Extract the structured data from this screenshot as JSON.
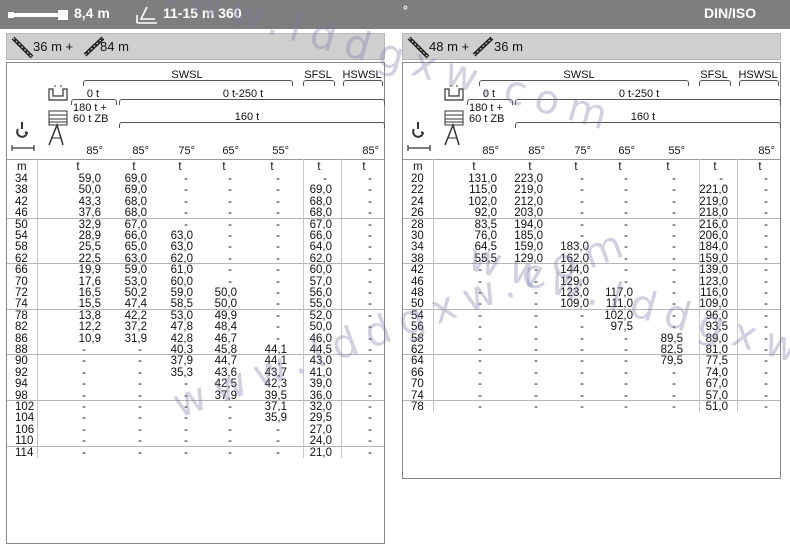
{
  "top_bar": {
    "boom_length": "8,4 m",
    "counterweight": "11-15 m 360",
    "degree": "°",
    "standard": "DIN/ISO"
  },
  "left": {
    "config_a": "36 m +",
    "config_b": "84 m",
    "swsl": "SWSL",
    "sfsl": "SFSL",
    "hswsl": "HSWSL",
    "ballast_low": "0 t",
    "ballast_range": "0 t-250 t",
    "ballast_extra": "180 t +\n60 t ZB",
    "ballast_main": "160 t",
    "angles": [
      "85°",
      "85°",
      "75°",
      "65°",
      "55°",
      "",
      "85°"
    ],
    "units": [
      "m",
      "t",
      "t",
      "t",
      "t",
      "t",
      "t",
      "t"
    ],
    "rows": [
      [
        "34",
        "59,0",
        "69,0",
        "-",
        "-",
        "-",
        "-",
        "-"
      ],
      [
        "38",
        "50,0",
        "69,0",
        "-",
        "-",
        "-",
        "69,0",
        "-"
      ],
      [
        "42",
        "43,3",
        "68,0",
        "-",
        "-",
        "-",
        "68,0",
        "-"
      ],
      [
        "46",
        "37,6",
        "68,0",
        "-",
        "-",
        "-",
        "68,0",
        "-"
      ],
      [
        "50",
        "32,9",
        "67,0",
        "-",
        "-",
        "-",
        "67,0",
        "-"
      ],
      [
        "54",
        "28,9",
        "66,0",
        "63,0",
        "-",
        "-",
        "66,0",
        "-"
      ],
      [
        "58",
        "25,5",
        "65,0",
        "63,0",
        "-",
        "-",
        "64,0",
        "-"
      ],
      [
        "62",
        "22,5",
        "63,0",
        "62,0",
        "-",
        "-",
        "62,0",
        "-"
      ],
      [
        "66",
        "19,9",
        "59,0",
        "61,0",
        "-",
        "-",
        "60,0",
        "-"
      ],
      [
        "70",
        "17,6",
        "53,0",
        "60,0",
        "-",
        "-",
        "57,0",
        "-"
      ],
      [
        "72",
        "16,5",
        "50,2",
        "59,0",
        "50,0",
        "-",
        "56,0",
        "-"
      ],
      [
        "74",
        "15,5",
        "47,4",
        "58,5",
        "50,0",
        "-",
        "55,0",
        "-"
      ],
      [
        "78",
        "13,8",
        "42,2",
        "53,0",
        "49,9",
        "-",
        "52,0",
        "-"
      ],
      [
        "82",
        "12,2",
        "37,2",
        "47,8",
        "48,4",
        "-",
        "50,0",
        "-"
      ],
      [
        "86",
        "10,9",
        "31,9",
        "42,8",
        "46,7",
        "-",
        "46,0",
        "-"
      ],
      [
        "88",
        "-",
        "-",
        "40,3",
        "45,8",
        "44,1",
        "44,5",
        "-"
      ],
      [
        "90",
        "-",
        "-",
        "37,9",
        "44,7",
        "44,1",
        "43,0",
        "-"
      ],
      [
        "92",
        "-",
        "-",
        "35,3",
        "43,6",
        "43,7",
        "41,0",
        "-"
      ],
      [
        "94",
        "-",
        "-",
        "-",
        "42,5",
        "42,3",
        "39,0",
        "-"
      ],
      [
        "98",
        "-",
        "-",
        "-",
        "37,9",
        "39,5",
        "36,0",
        "-"
      ],
      [
        "102",
        "-",
        "-",
        "-",
        "-",
        "37,1",
        "32,0",
        "-"
      ],
      [
        "104",
        "-",
        "-",
        "-",
        "-",
        "35,9",
        "29,5",
        "-"
      ],
      [
        "106",
        "-",
        "-",
        "-",
        "-",
        "-",
        "27,0",
        "-"
      ],
      [
        "110",
        "-",
        "-",
        "-",
        "-",
        "-",
        "24,0",
        "-"
      ],
      [
        "114",
        "-",
        "-",
        "-",
        "-",
        "-",
        "21,0",
        "-"
      ]
    ]
  },
  "right": {
    "config_a": "48 m +",
    "config_b": "36 m",
    "swsl": "SWSL",
    "sfsl": "SFSL",
    "hswsl": "HSWSL",
    "ballast_low": "0 t",
    "ballast_range": "0 t-250 t",
    "ballast_extra": "180 t +\n60 t ZB",
    "ballast_main": "160 t",
    "angles": [
      "85°",
      "85°",
      "75°",
      "65°",
      "55°",
      "",
      "85°"
    ],
    "units": [
      "m",
      "t",
      "t",
      "t",
      "t",
      "t",
      "t",
      "t"
    ],
    "rows": [
      [
        "20",
        "131,0",
        "223,0",
        "-",
        "-",
        "-",
        "-",
        "-"
      ],
      [
        "22",
        "115,0",
        "219,0",
        "-",
        "-",
        "-",
        "221,0",
        "-"
      ],
      [
        "24",
        "102,0",
        "212,0",
        "-",
        "-",
        "-",
        "219,0",
        "-"
      ],
      [
        "26",
        "92,0",
        "203,0",
        "-",
        "-",
        "-",
        "218,0",
        "-"
      ],
      [
        "28",
        "83,5",
        "194,0",
        "-",
        "-",
        "-",
        "216,0",
        "-"
      ],
      [
        "30",
        "76,0",
        "185,0",
        "-",
        "-",
        "-",
        "206,0",
        "-"
      ],
      [
        "34",
        "64,5",
        "159,0",
        "183,0",
        "-",
        "-",
        "184,0",
        "-"
      ],
      [
        "38",
        "55,5",
        "129,0",
        "162,0",
        "-",
        "-",
        "159,0",
        "-"
      ],
      [
        "42",
        "-",
        "-",
        "144,0",
        "-",
        "-",
        "139,0",
        "-"
      ],
      [
        "46",
        "-",
        "-",
        "129,0",
        "-",
        "-",
        "123,0",
        "-"
      ],
      [
        "48",
        "-",
        "-",
        "123,0",
        "117,0",
        "-",
        "116,0",
        "-"
      ],
      [
        "50",
        "-",
        "-",
        "109,0",
        "111,0",
        "-",
        "109,0",
        "-"
      ],
      [
        "54",
        "-",
        "-",
        "-",
        "102,0",
        "-",
        "96,0",
        "-"
      ],
      [
        "56",
        "-",
        "-",
        "-",
        "97,5",
        "-",
        "93,5",
        "-"
      ],
      [
        "58",
        "-",
        "-",
        "-",
        "-",
        "89,5",
        "89,0",
        "-"
      ],
      [
        "62",
        "-",
        "-",
        "-",
        "-",
        "82,5",
        "81,0",
        "-"
      ],
      [
        "64",
        "-",
        "-",
        "-",
        "-",
        "79,5",
        "77,5",
        "-"
      ],
      [
        "66",
        "-",
        "-",
        "-",
        "-",
        "-",
        "74,0",
        "-"
      ],
      [
        "70",
        "-",
        "-",
        "-",
        "-",
        "-",
        "67,0",
        "-"
      ],
      [
        "74",
        "-",
        "-",
        "-",
        "-",
        "-",
        "57,0",
        "-"
      ],
      [
        "78",
        "-",
        "-",
        "-",
        "-",
        "-",
        "51,0",
        "-"
      ]
    ]
  },
  "colors": {
    "top_bar": "#7e7e7e",
    "panel_header": "#cfcfcf",
    "watermark": "#7878aa"
  }
}
